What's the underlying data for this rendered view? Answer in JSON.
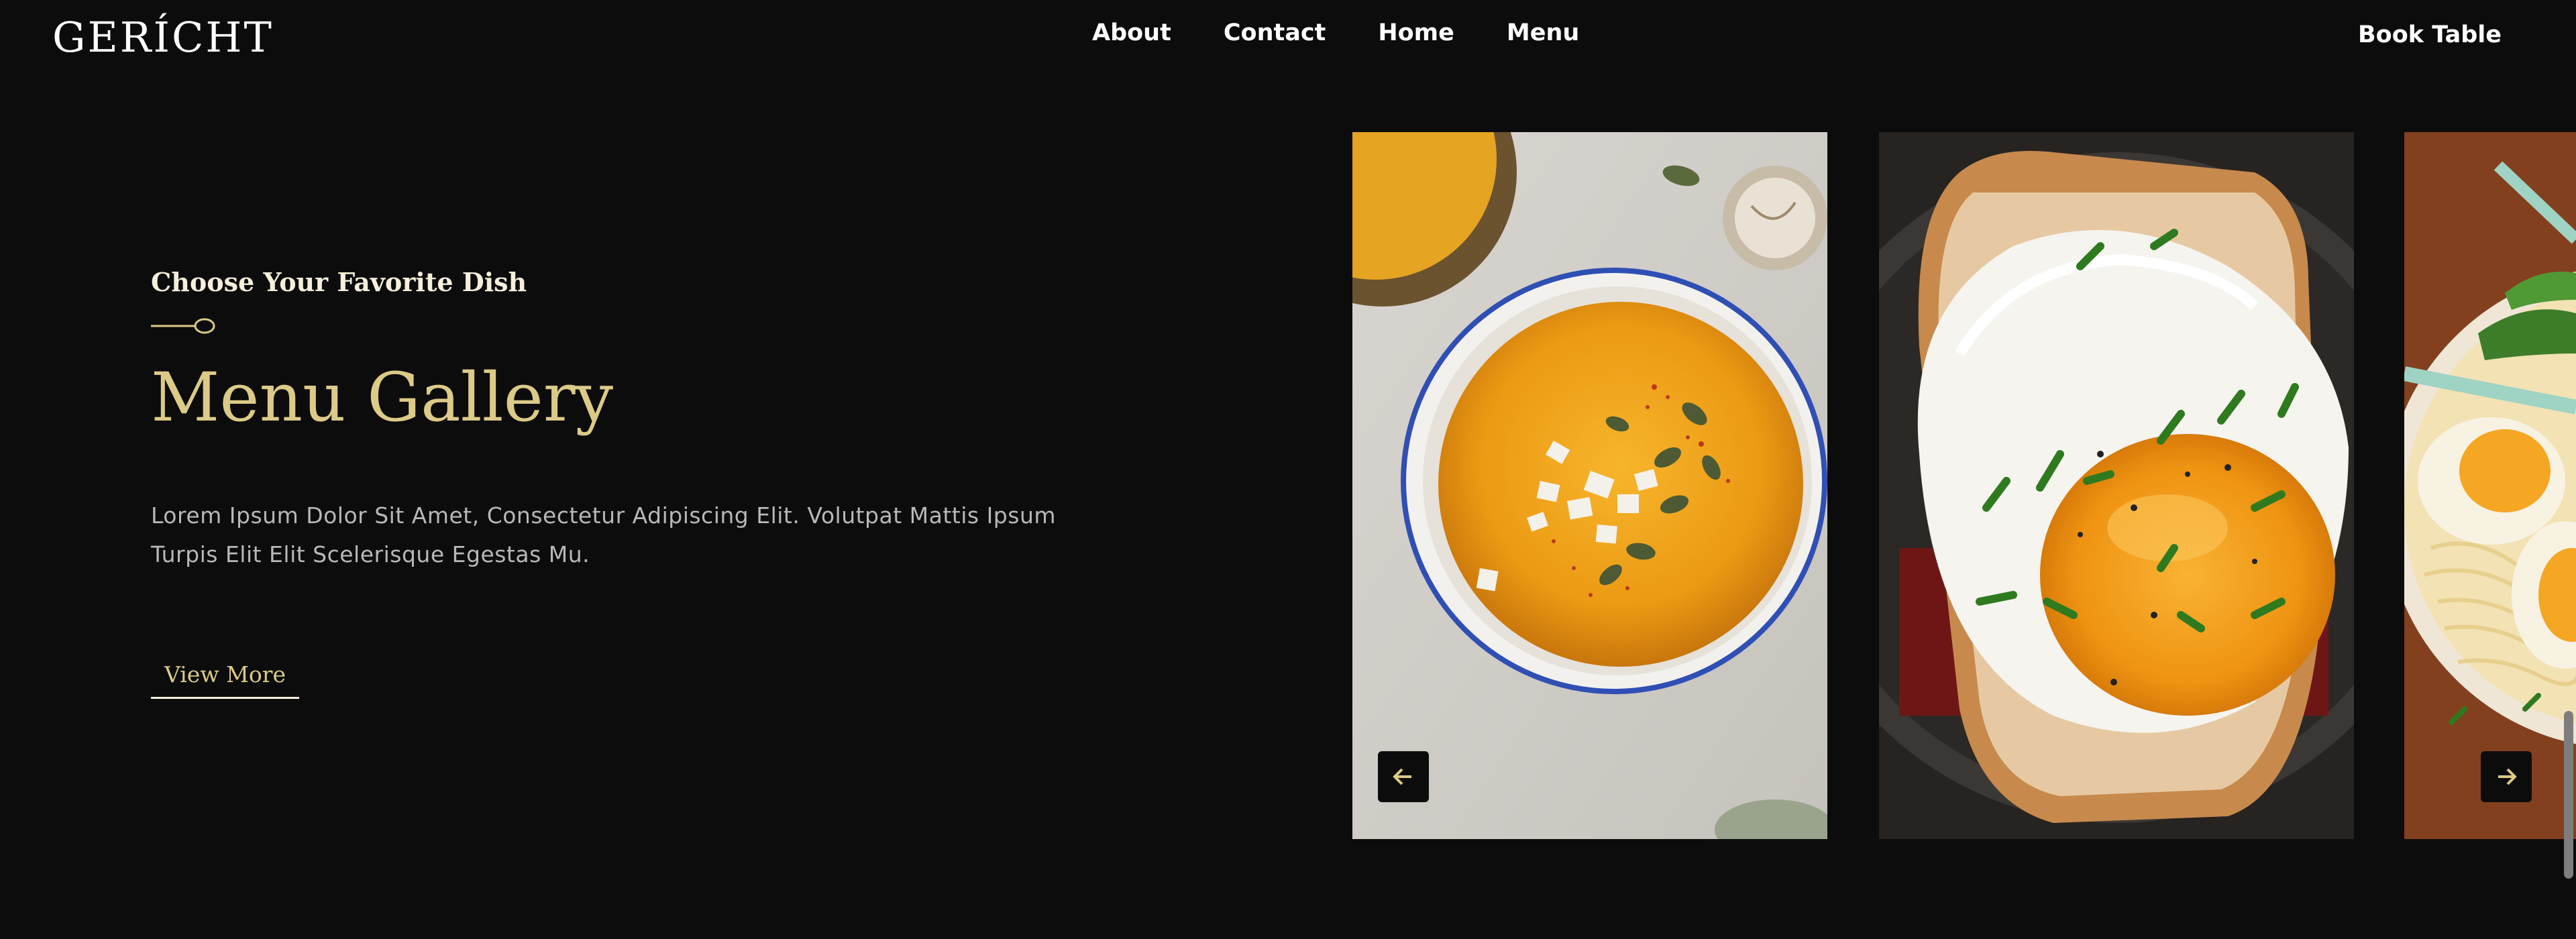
{
  "brand": {
    "logo": "GERÍCHT"
  },
  "nav": {
    "items": [
      "About",
      "Contact",
      "Home",
      "Menu"
    ],
    "cta": "Book Table"
  },
  "hero": {
    "subtitle": "Choose Your Favorite Dish",
    "title": "Menu Gallery",
    "description_line1": "Lorem Ipsum Dolor Sit Amet, Consectetur Adipiscing Elit. Volutpat Mattis Ipsum",
    "description_line2": "Turpis Elit Elit Scelerisque Egestas Mu.",
    "button": "View More"
  },
  "gallery": {
    "images": [
      "pumpkin-soup",
      "fried-egg-toast",
      "ramen-bowl"
    ],
    "prev_icon": "arrow-left-icon",
    "next_icon": "arrow-right-icon"
  },
  "colors": {
    "background": "#0c0c0c",
    "gold": "#dcca87",
    "cream": "#f5efdb",
    "text_gray": "#b8b8b8"
  }
}
